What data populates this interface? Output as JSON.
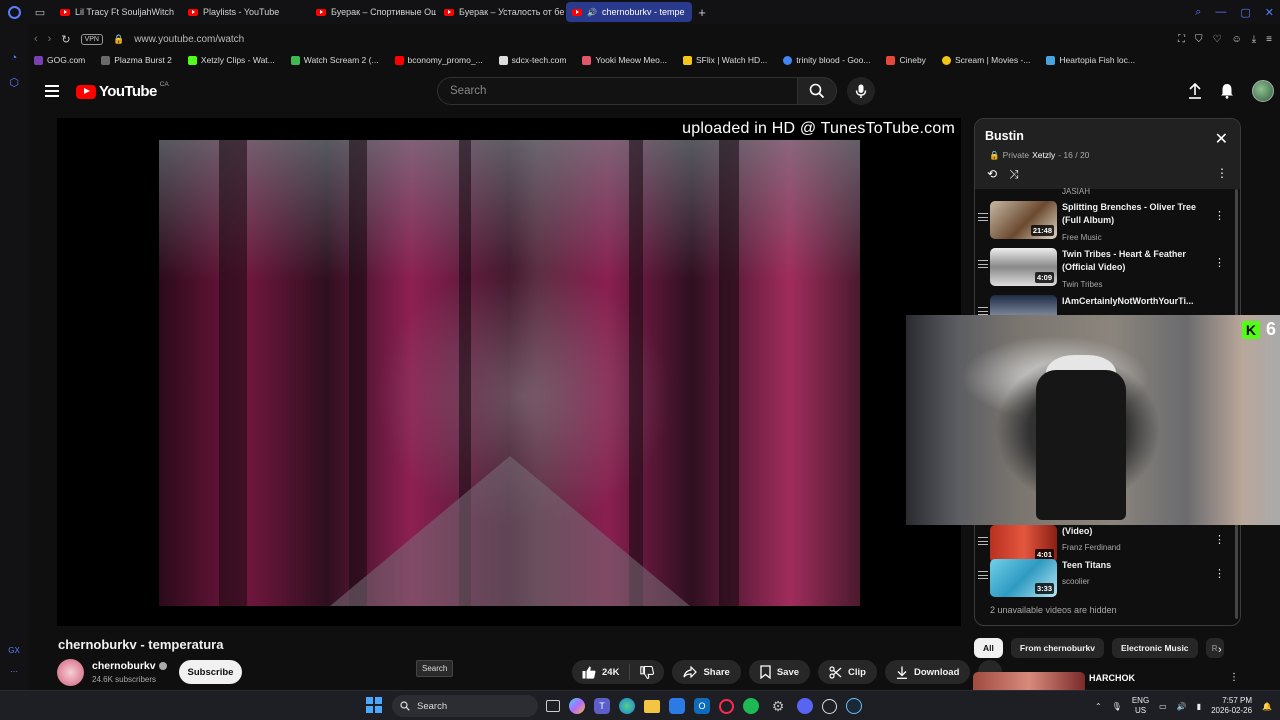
{
  "browser": {
    "tabs": [
      {
        "label": "Lil Tracy Ft SouljahWitch",
        "active": false
      },
      {
        "label": "Playlists - YouTube",
        "active": false
      },
      {
        "label": "Буерак – Спортивные Ощ",
        "active": false
      },
      {
        "label": "Буерак – Усталость от бе",
        "active": false
      },
      {
        "label": "chernoburkv - tempe",
        "active": true
      }
    ],
    "new_tab_label": "+",
    "url": "www.youtube.com/watch",
    "vpn_label": "VPN",
    "bookmarks": [
      {
        "label": "GOG.com",
        "color": "#7a3fb1"
      },
      {
        "label": "Plazma Burst 2",
        "color": "#6a6a6a"
      },
      {
        "label": "Xetzly Clips - Wat...",
        "color": "#53fc18"
      },
      {
        "label": "Watch Scream 2 (...",
        "color": "#3fb950"
      },
      {
        "label": "bconomy_promo_...",
        "color": "#ff0000"
      },
      {
        "label": "sdcx-tech.com",
        "color": "#dddddd"
      },
      {
        "label": "Yooki Meow Meo...",
        "color": "#e4566b"
      },
      {
        "label": "SFlix | Watch HD...",
        "color": "#f5c518"
      },
      {
        "label": "trinity blood - Goo...",
        "color": "#4285f4"
      },
      {
        "label": "Cineby",
        "color": "#e5483b"
      },
      {
        "label": "Scream | Movies -...",
        "color": "#f0c419"
      },
      {
        "label": "Heartopia Fish loc...",
        "color": "#4aa3df"
      }
    ],
    "sidebar_bottom_label": "GX"
  },
  "youtube": {
    "logo_text": "YouTube",
    "country_code": "CA",
    "search": {
      "placeholder": "Search"
    }
  },
  "player": {
    "watermark": "uploaded in HD @ TunesToTube.com"
  },
  "video": {
    "title": "chernoburkv - temperatura",
    "channel_name": "chernoburkv",
    "subscribers": "24.6K subscribers",
    "subscribe_label": "Subscribe",
    "like_count": "24K",
    "share_label": "Share",
    "save_label": "Save",
    "clip_label": "Clip",
    "download_label": "Download"
  },
  "tooltip": "Search",
  "playlist": {
    "title": "Bustin",
    "privacy": "Private",
    "owner": "Xetzly",
    "position": "- 16 / 20",
    "items": [
      {
        "title": "",
        "channel": "JASIAH",
        "duration": ""
      },
      {
        "title": "Splitting Brenches - Oliver Tree (Full Album)",
        "channel": "Free Music",
        "duration": "21:48"
      },
      {
        "title": "Twin Tribes - Heart & Feather (Official Video)",
        "channel": "Twin Tribes",
        "duration": "4:09"
      },
      {
        "title": "IAmCertainlyNotWorthYourTi...",
        "channel": "",
        "duration": ""
      },
      {
        "title": "(Video)",
        "channel": "Franz Ferdinand",
        "duration": "4:01"
      },
      {
        "title": "Teen Titans",
        "channel": "scoolier",
        "duration": "3:33"
      }
    ],
    "hidden_note": "2 unavailable videos are hidden"
  },
  "webcam": {
    "viewer_count": "6",
    "platform": "kick"
  },
  "chips": [
    {
      "label": "All",
      "active": true
    },
    {
      "label": "From chernoburkv",
      "active": false
    },
    {
      "label": "Electronic Music",
      "active": false
    },
    {
      "label": "R",
      "active": false
    }
  ],
  "recommended": {
    "title": "HARCHOK"
  },
  "taskbar": {
    "search_placeholder": "Search",
    "language": "ENG",
    "region": "US",
    "time": "7:57 PM",
    "date": "2026-02-26"
  },
  "colors": {
    "accent_red": "#ff0000",
    "browser_accent": "#5a7cff",
    "kick_green": "#53fc18"
  }
}
